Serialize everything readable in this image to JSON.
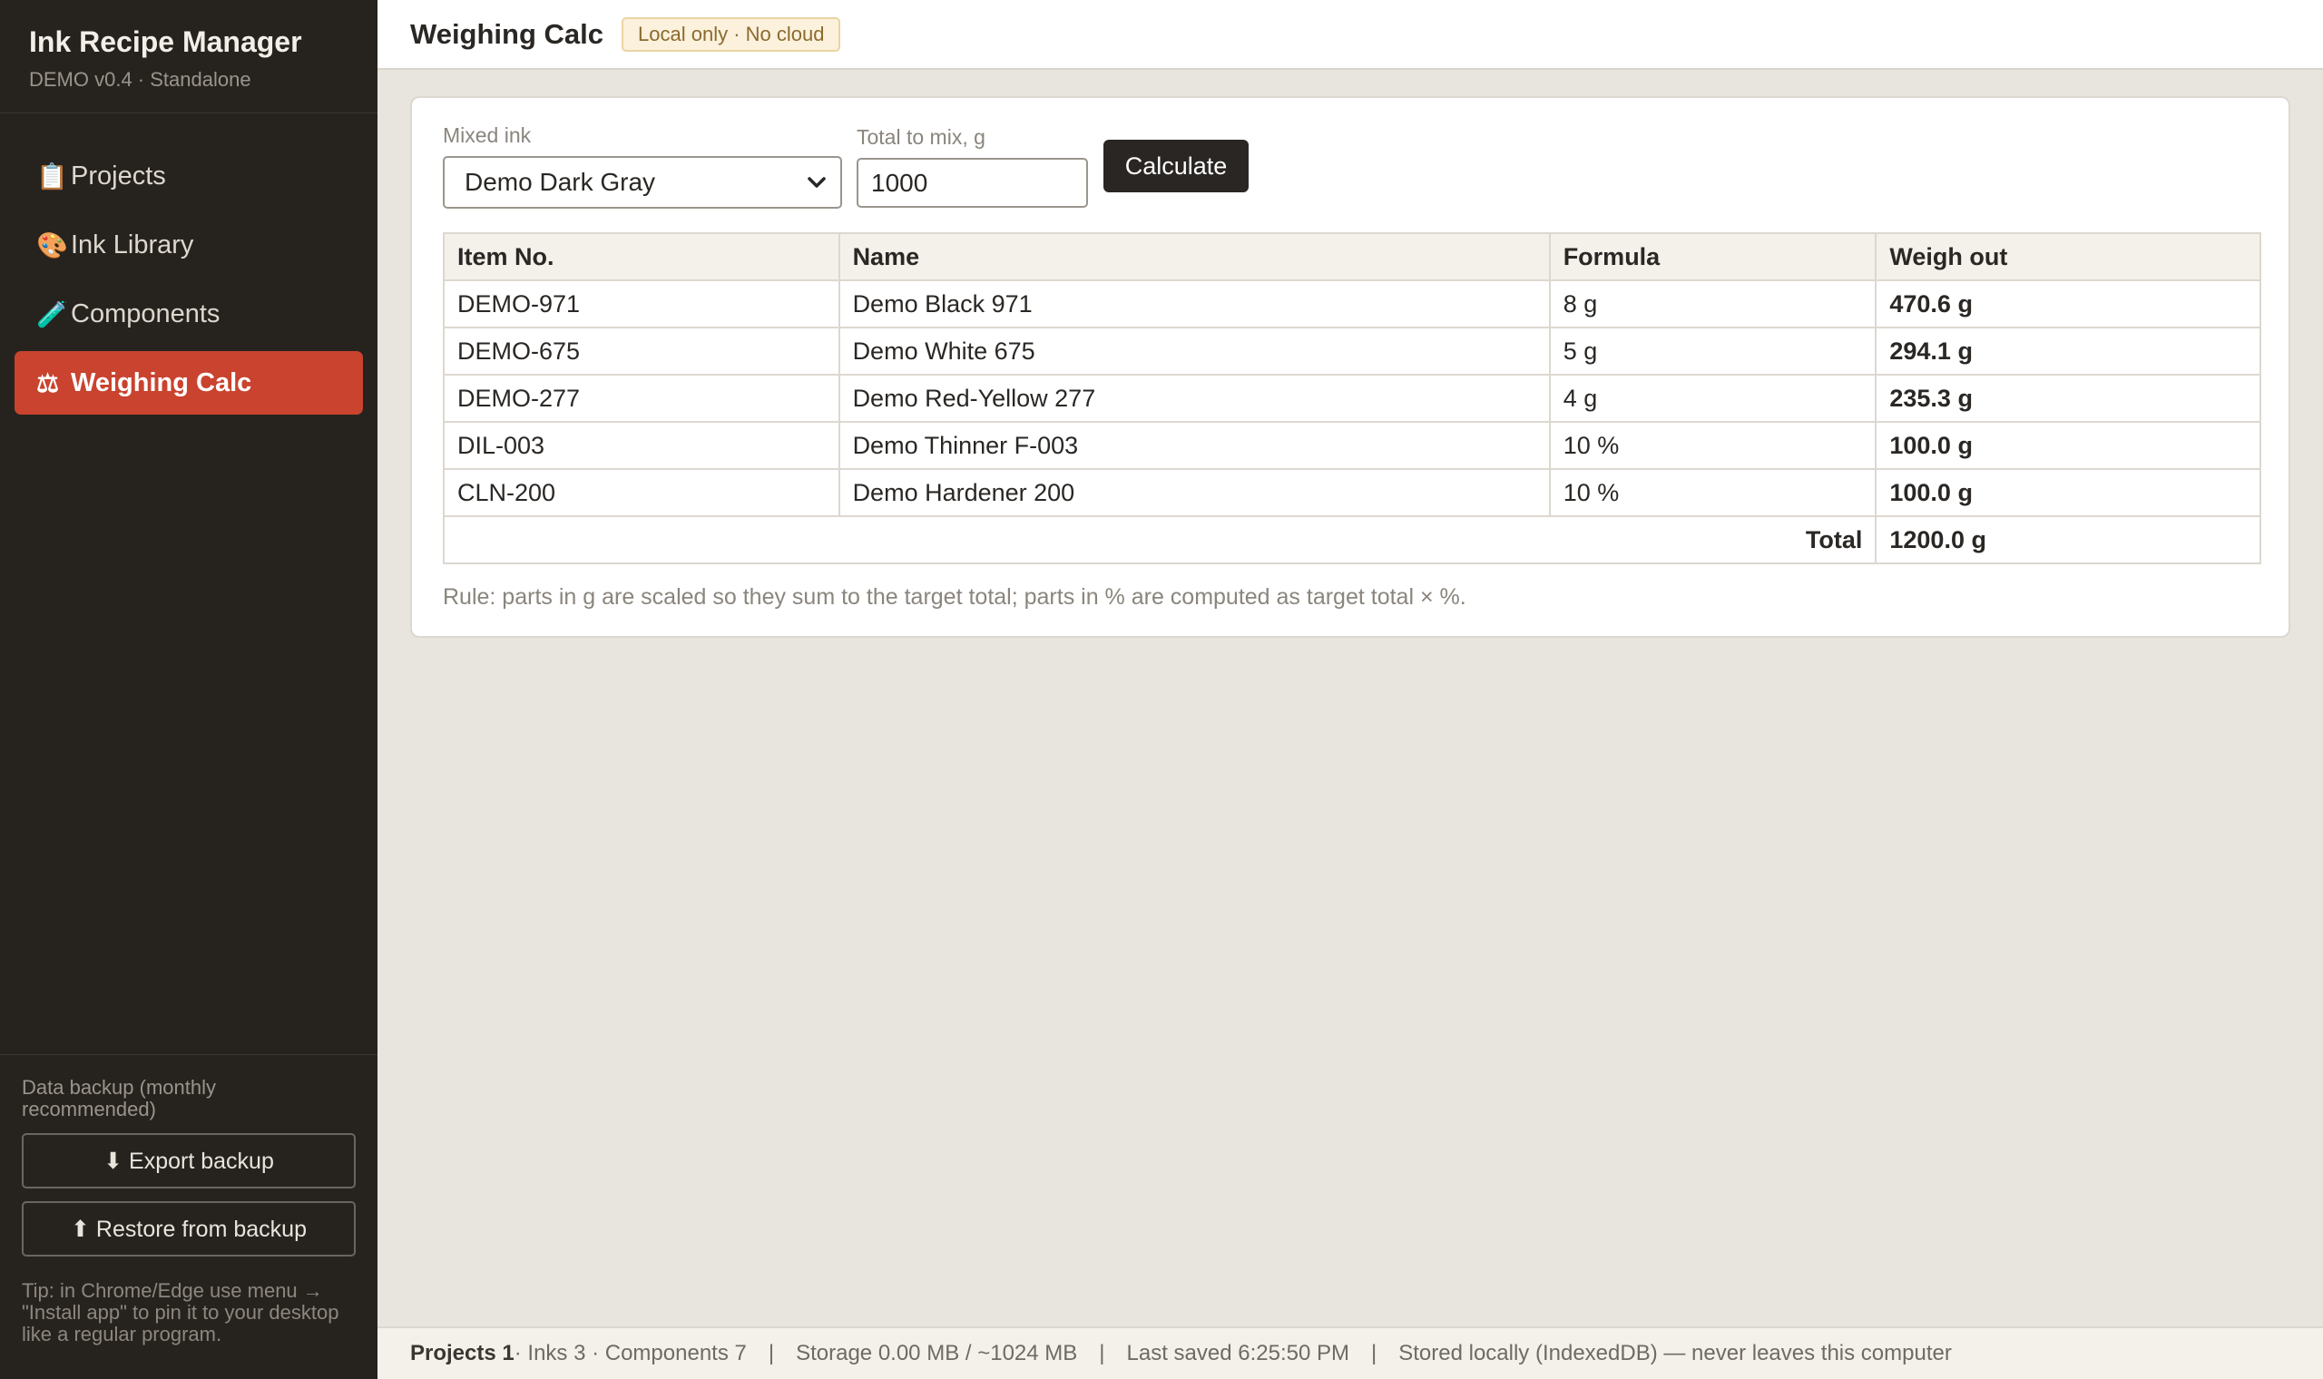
{
  "app": {
    "title": "Ink Recipe Manager",
    "subtitle": "DEMO v0.4 · Standalone"
  },
  "nav": {
    "items": [
      {
        "icon": "📋",
        "label": "Projects",
        "icon_name": "clipboard-icon"
      },
      {
        "icon": "🎨",
        "label": "Ink Library",
        "icon_name": "palette-icon"
      },
      {
        "icon": "🧪",
        "label": "Components",
        "icon_name": "test-tube-icon"
      },
      {
        "icon": "⚖",
        "label": "Weighing Calc",
        "icon_name": "scale-icon",
        "active": true
      }
    ]
  },
  "sidebar_footer": {
    "backup_label": "Data backup (monthly recommended)",
    "export_label": "⬇ Export backup",
    "restore_label": "⬆ Restore from backup",
    "tip": "Tip: in Chrome/Edge use menu → \"Install app\" to pin it to your desktop like a regular program."
  },
  "header": {
    "title": "Weighing Calc",
    "badge": "Local only · No cloud"
  },
  "form": {
    "ink_label": "Mixed ink",
    "ink_value": "Demo Dark Gray",
    "total_label": "Total to mix, g",
    "total_value": "1000",
    "calculate_label": "Calculate"
  },
  "table": {
    "headers": [
      "Item No.",
      "Name",
      "Formula",
      "Weigh out"
    ],
    "rows": [
      [
        "DEMO-971",
        "Demo Black 971",
        "8 g",
        "470.6 g"
      ],
      [
        "DEMO-675",
        "Demo White 675",
        "5 g",
        "294.1 g"
      ],
      [
        "DEMO-277",
        "Demo Red-Yellow 277",
        "4 g",
        "235.3 g"
      ],
      [
        "DIL-003",
        "Demo Thinner F-003",
        "10 %",
        "100.0 g"
      ],
      [
        "CLN-200",
        "Demo Hardener 200",
        "10 %",
        "100.0 g"
      ]
    ],
    "total_label": "Total",
    "total_value": "1200.0 g"
  },
  "rule_text": "Rule: parts in g are scaled so they sum to the target total; parts in % are computed as target total × %.",
  "status": {
    "projects": "Projects 1",
    "counts": " · Inks 3 · Components 7",
    "storage": "Storage 0.00 MB / ~1024 MB",
    "last_saved": "Last saved 6:25:50 PM",
    "stored": "Stored locally (IndexedDB) — never leaves this computer",
    "separator": "|"
  },
  "colors": {
    "sidebar_bg": "#26231f",
    "accent": "#c9432e",
    "badge_bg": "#fbf1dc"
  }
}
